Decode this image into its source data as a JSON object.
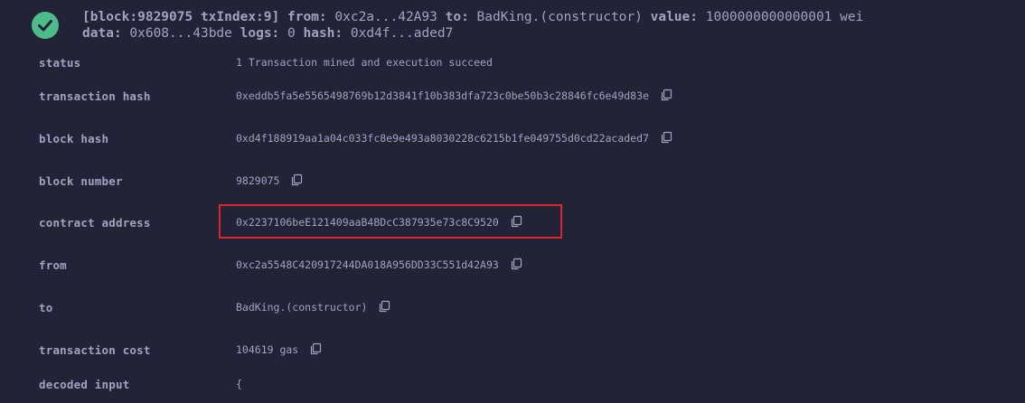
{
  "header": {
    "line1": {
      "block_token": "[block:9829075 txIndex:9]",
      "from_key": "from:",
      "from_val": "0xc2a...42A93",
      "to_key": "to:",
      "to_val": "BadKing.(constructor)",
      "value_key": "value:",
      "value_val": "1000000000000001 wei"
    },
    "line2": {
      "data_key": "data:",
      "data_val": "0x608...43bde",
      "logs_key": "logs:",
      "logs_val": "0",
      "hash_key": "hash:",
      "hash_val": "0xd4f...aded7"
    }
  },
  "rows": [
    {
      "key": "status",
      "value": "1 Transaction mined and execution succeed",
      "copy": false
    },
    {
      "key": "transaction hash",
      "value": "0xeddb5fa5e5565498769b12d3841f10b383dfa723c0be50b3c28846fc6e49d83e",
      "copy": true
    },
    {
      "key": "block hash",
      "value": "0xd4f188919aa1a04c033fc8e9e493a8030228c6215b1fe049755d0cd22acaded7",
      "copy": true
    },
    {
      "key": "block number",
      "value": "9829075",
      "copy": true
    },
    {
      "key": "contract address",
      "value": "0x2237106beE121409aaB4BDcC387935e73c8C9520",
      "copy": true
    },
    {
      "key": "from",
      "value": "0xc2a5548C420917244DA018A956DD33C551d42A93",
      "copy": true
    },
    {
      "key": "to",
      "value": "BadKing.(constructor)",
      "copy": true
    },
    {
      "key": "transaction cost",
      "value": "104619 gas",
      "copy": true
    },
    {
      "key": "decoded input",
      "value": "{",
      "copy": false
    }
  ],
  "icons": {
    "status_icon": "check-circle-icon",
    "copy_icon": "copy-icon"
  },
  "colors": {
    "background": "#222336",
    "text": "#a2a3bd",
    "success": "#4dbb8a",
    "highlight": "#d9262c"
  }
}
